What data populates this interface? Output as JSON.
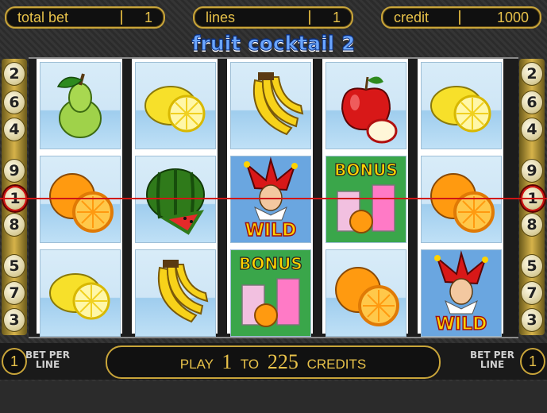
{
  "hud": {
    "total_bet_label": "total bet",
    "total_bet_value": "1",
    "lines_label": "lines",
    "lines_value": "1",
    "credit_label": "credit",
    "credit_value": "1000"
  },
  "title": "fruit cocktail 2",
  "line_numbers_left": [
    "2",
    "6",
    "4",
    "9",
    "1",
    "8",
    "5",
    "7",
    "3"
  ],
  "line_numbers_right": [
    "2",
    "6",
    "4",
    "9",
    "1",
    "8",
    "5",
    "7",
    "3"
  ],
  "active_line": "1",
  "reels": [
    [
      "pear",
      "orange",
      "lemon"
    ],
    [
      "lemon",
      "watermelon",
      "banana"
    ],
    [
      "banana",
      "wild",
      "bonus"
    ],
    [
      "apple",
      "bonus",
      "orange"
    ],
    [
      "lemon",
      "orange",
      "wild"
    ]
  ],
  "symbol_text": {
    "wild": "WILD",
    "bonus": "BONUS"
  },
  "bottom": {
    "left_circle": "1",
    "bet_per_line_left": [
      "BET PER",
      "LINE"
    ],
    "play_prefix": "PLAY",
    "play_min": "1",
    "play_mid": "TO",
    "play_max": "225",
    "play_suffix": "CREDITS",
    "bet_per_line_right": [
      "BET PER",
      "LINE"
    ],
    "right_circle": "1"
  },
  "colors": {
    "gold": "#c9a53a",
    "payline": "#d01515",
    "title_blue": "#6aa6ff"
  }
}
